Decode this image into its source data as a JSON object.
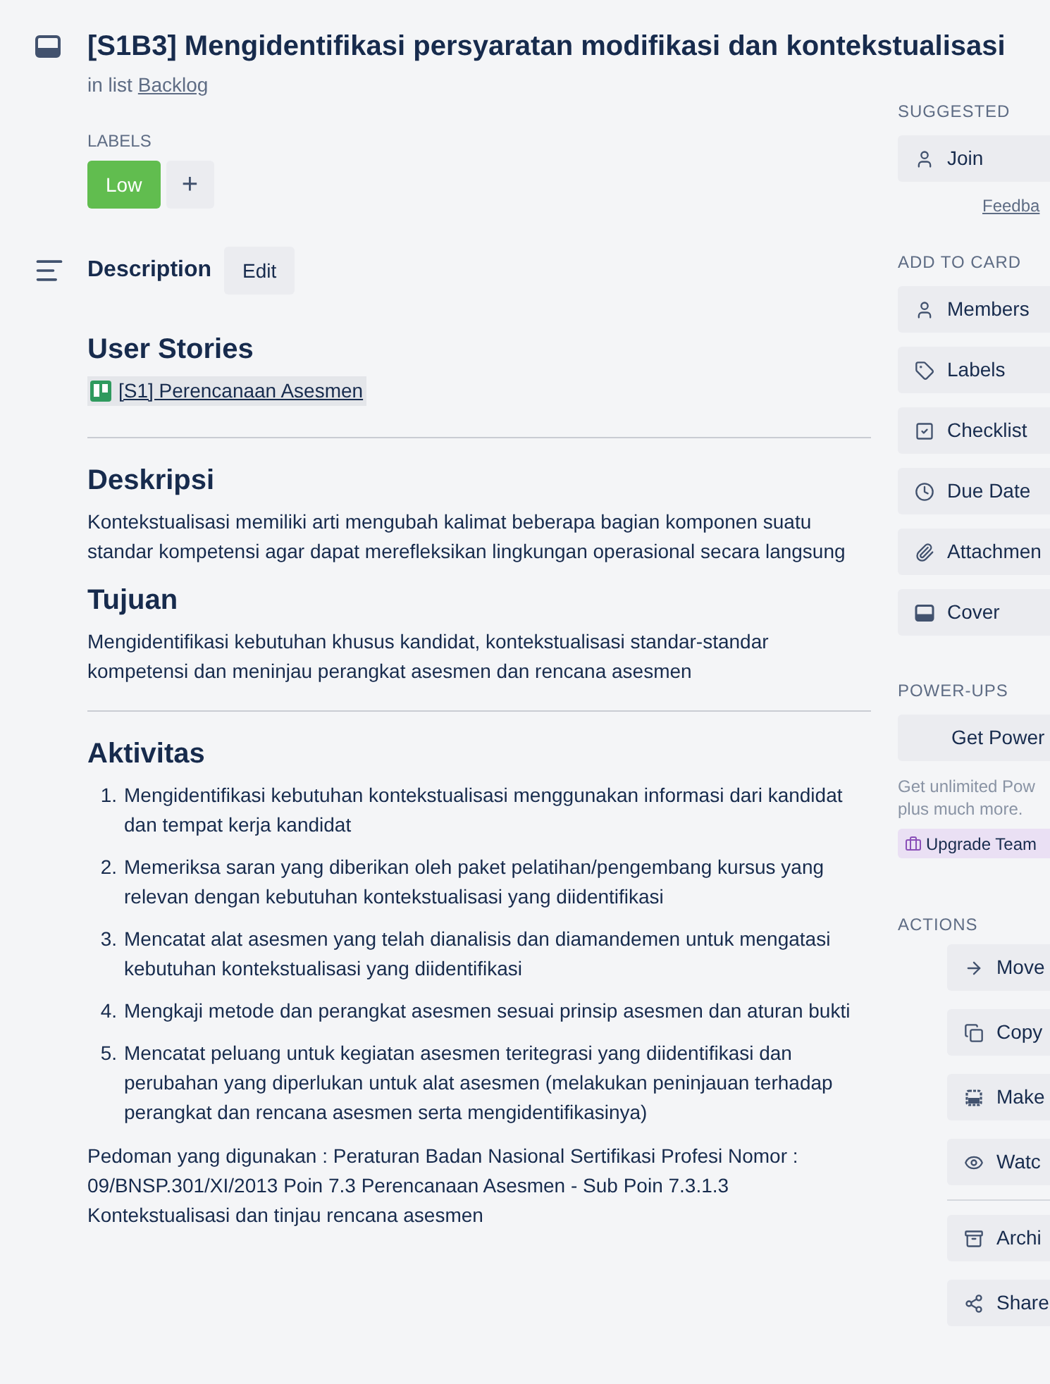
{
  "card": {
    "title": "[S1B3] Mengidentifikasi persyaratan modifikasi dan kontekstualisasi",
    "list_prefix": "in list",
    "list_name": "Backlog"
  },
  "labels": {
    "heading": "LABELS",
    "items": [
      {
        "text": "Low",
        "color": "#61bd4f"
      }
    ],
    "add": "+"
  },
  "description": {
    "heading": "Description",
    "edit": "Edit"
  },
  "blocks": [
    {
      "kind": "heading",
      "text": "User Stories"
    },
    {
      "kind": "link",
      "text": "[S1] Perencanaan Asesmen"
    },
    {
      "kind": "rule"
    },
    {
      "kind": "heading",
      "text": "Deskripsi"
    },
    {
      "kind": "paragraph",
      "text": "Kontekstualisasi memiliki arti mengubah kalimat beberapa bagian komponen suatu standar kompetensi agar dapat merefleksikan lingkungan operasional secara langsung"
    },
    {
      "kind": "heading",
      "text": "Tujuan"
    },
    {
      "kind": "paragraph",
      "text": "Mengidentifikasi kebutuhan khusus kandidat, kontekstualisasi standar-standar kompetensi dan meninjau perangkat asesmen dan rencana asesmen"
    },
    {
      "kind": "rule"
    },
    {
      "kind": "heading",
      "text": "Aktivitas"
    },
    {
      "kind": "list",
      "items": [
        {
          "number": "1.",
          "text": "Mengidentifikasi kebutuhan kontekstualisasi menggunakan informasi dari kandidat dan tempat kerja kandidat"
        },
        {
          "number": "2.",
          "text": "Memeriksa saran yang diberikan oleh paket pelatihan/pengembang kursus yang relevan dengan kebutuhan kontekstualisasi yang diidentifikasi"
        },
        {
          "number": "3.",
          "text": "Mencatat alat asesmen yang telah dianalisis dan diamandemen untuk mengatasi kebutuhan kontekstualisasi yang diidentifikasi"
        },
        {
          "number": "4.",
          "text": "Mengkaji metode dan perangkat asesmen sesuai prinsip asesmen dan aturan bukti"
        },
        {
          "number": "5.",
          "text": "Mencatat peluang untuk kegiatan asesmen teritegrasi yang diidentifikasi dan perubahan yang diperlukan untuk alat asesmen (melakukan peninjauan terhadap perangkat dan rencana asesmen serta mengidentifikasinya)"
        }
      ]
    },
    {
      "kind": "paragraph",
      "text": "Pedoman yang digunakan : Peraturan Badan Nasional Sertifikasi Profesi Nomor : 09/BNSP.301/XI/2013 Poin 7.3 Perencanaan Asesmen - Sub Poin 7.3.1.3 Kontekstualisasi dan tinjau rencana asesmen"
    }
  ],
  "sidebar": {
    "suggested": {
      "heading": "SUGGESTED",
      "button": "Join",
      "link": "Feedba"
    },
    "add_to_card": {
      "heading": "ADD TO CARD",
      "buttons": [
        "Members",
        "Labels",
        "Checklist",
        "Due Date",
        "Attachmen",
        "Cover"
      ]
    },
    "power_ups": {
      "heading": "POWER-UPS",
      "button": "Get Power",
      "note": [
        "Get unlimited Pow",
        "plus much more."
      ],
      "upgrade": "Upgrade Team"
    },
    "actions": {
      "heading": "ACTIONS",
      "buttons": [
        "Move",
        "Copy",
        "Make",
        "Watc",
        "Archi",
        "Share"
      ]
    }
  }
}
